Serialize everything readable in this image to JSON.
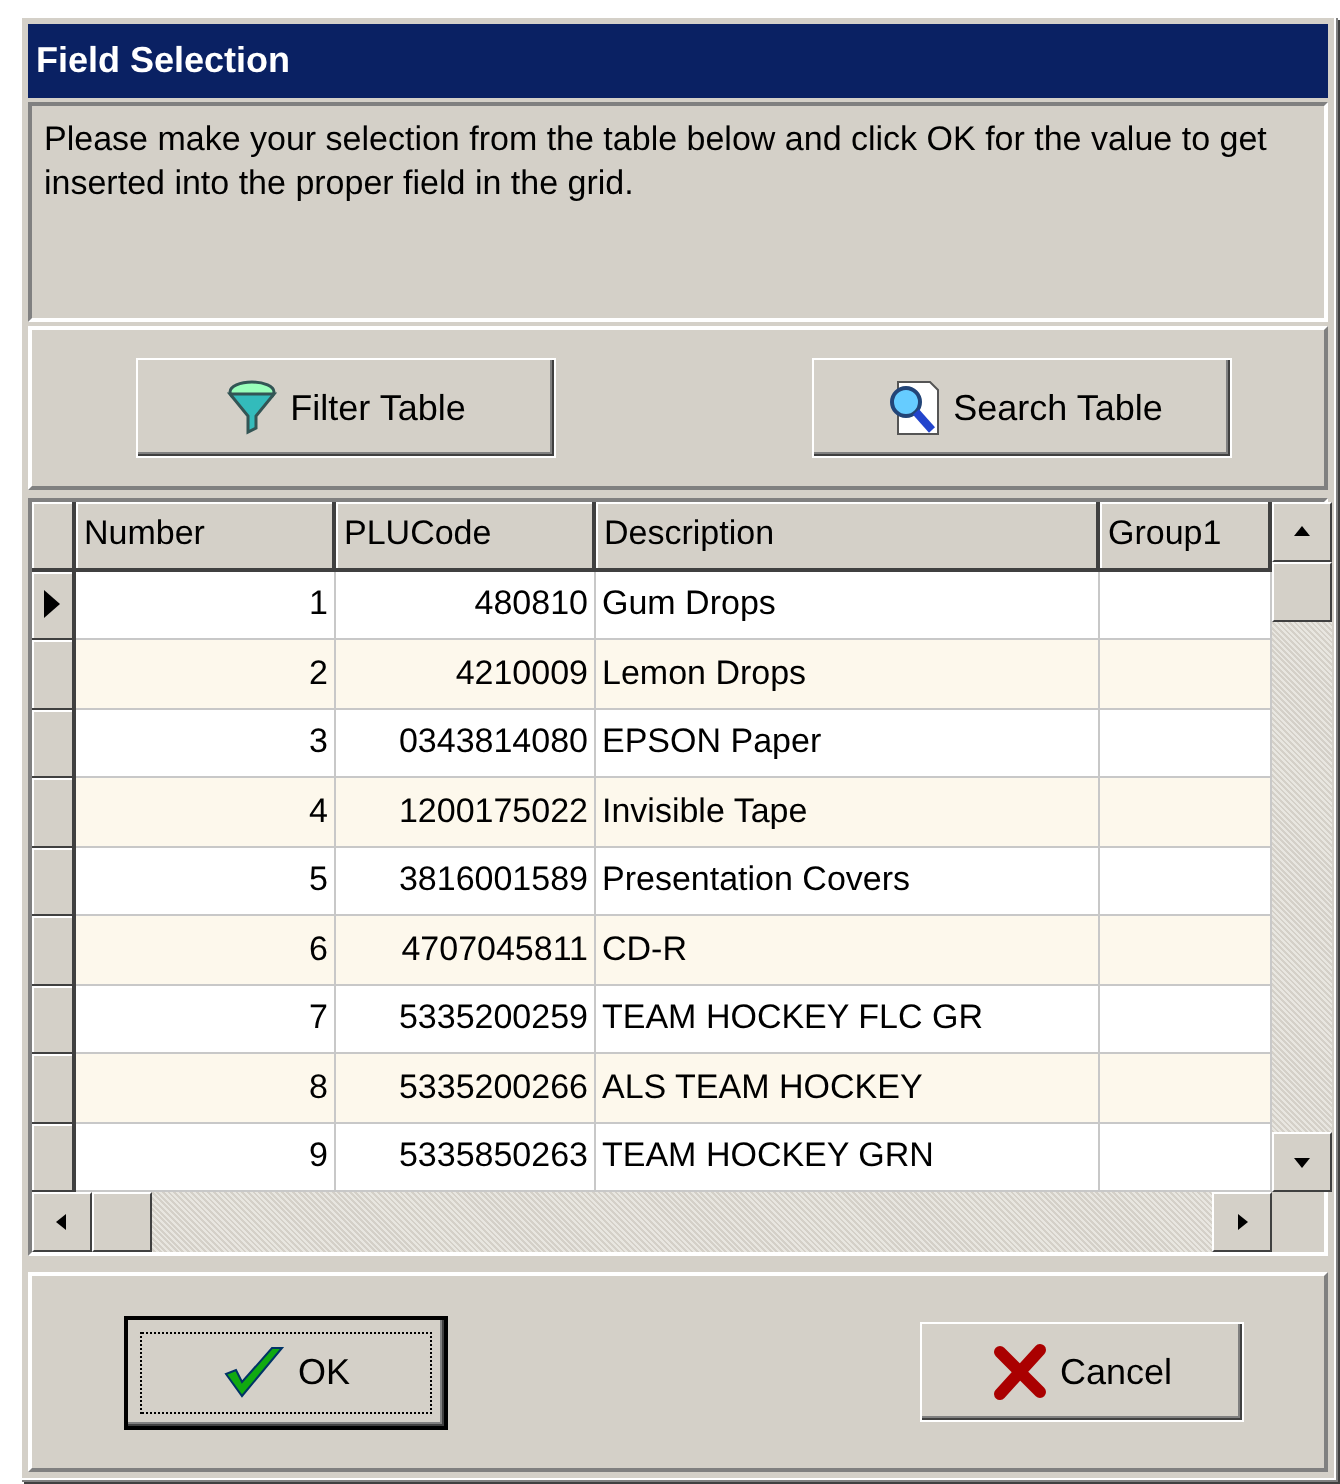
{
  "window": {
    "title": "Field Selection"
  },
  "message": "Please make your selection from the table below and click OK for the value to get inserted into the proper field in the grid.",
  "toolbar": [
    {
      "label": "Filter Table",
      "kind": "filter"
    },
    {
      "label": "Search Table",
      "kind": "search"
    }
  ],
  "table": {
    "columns": [
      "Number",
      "PLUCode",
      "Description",
      "Group1"
    ],
    "rows": [
      {
        "cells": [
          "1",
          "480810",
          "Gum Drops"
        ],
        "selected": true
      },
      {
        "cells": [
          "2",
          "4210009",
          "Lemon Drops"
        ],
        "selected": false
      },
      {
        "cells": [
          "3",
          "0343814080",
          "EPSON Paper"
        ],
        "selected": false
      },
      {
        "cells": [
          "4",
          "1200175022",
          "Invisible Tape"
        ],
        "selected": false
      },
      {
        "cells": [
          "5",
          "3816001589",
          "Presentation Covers"
        ],
        "selected": false
      },
      {
        "cells": [
          "6",
          "4707045811",
          "CD-R"
        ],
        "selected": false
      },
      {
        "cells": [
          "7",
          "5335200259",
          "TEAM HOCKEY FLC GR"
        ],
        "selected": false
      },
      {
        "cells": [
          "8",
          "5335200266",
          "ALS TEAM HOCKEY"
        ],
        "selected": false
      },
      {
        "cells": [
          "9",
          "5335850263",
          "TEAM HOCKEY GRN"
        ],
        "selected": false
      }
    ]
  },
  "buttons": [
    {
      "label": "OK",
      "kind": "ok",
      "default": true
    },
    {
      "label": "Cancel",
      "kind": "cancel",
      "default": false
    }
  ]
}
